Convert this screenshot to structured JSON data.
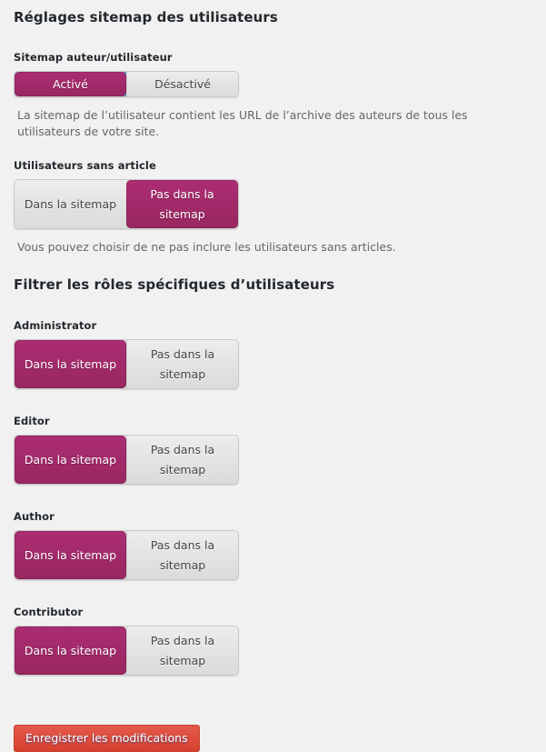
{
  "page": {
    "title": "Réglages sitemap des utilisateurs",
    "background_color": "#f1f1f1",
    "accent_color": "#a22a6a",
    "save_color": "#dd4b39"
  },
  "author_sitemap": {
    "label": "Sitemap auteur/utilisateur",
    "options": [
      {
        "label": "Activé",
        "selected": true
      },
      {
        "label": "Désactivé",
        "selected": false
      }
    ],
    "help": "La sitemap de l’utilisateur contient les URL de l’archive des auteurs de tous les utilisateurs de votre site."
  },
  "users_without_posts": {
    "label": "Utilisateurs sans article",
    "options": [
      {
        "label": "Dans la sitemap",
        "selected": false
      },
      {
        "label": "Pas dans la sitemap",
        "selected": true
      }
    ],
    "help": "Vous pouvez choisir de ne pas inclure les utilisateurs sans articles."
  },
  "roles_section": {
    "title": "Filtrer les rôles spécifiques d’utilisateurs",
    "option_in": "Dans la sitemap",
    "option_out": "Pas dans la sitemap",
    "roles": [
      {
        "name": "Administrator",
        "selected": "in"
      },
      {
        "name": "Editor",
        "selected": "in"
      },
      {
        "name": "Author",
        "selected": "in"
      },
      {
        "name": "Contributor",
        "selected": "in"
      }
    ]
  },
  "footer": {
    "save_label": "Enregistrer les modifications"
  }
}
